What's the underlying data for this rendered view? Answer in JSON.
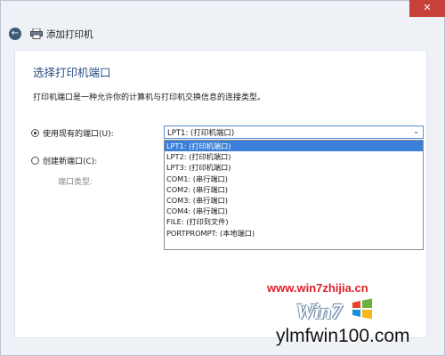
{
  "window": {
    "title": "添加打印机",
    "close_symbol": "✕",
    "back_symbol": "←"
  },
  "content": {
    "heading": "选择打印机端口",
    "description": "打印机端口是一种允许你的计算机与打印机交换信息的连接类型。"
  },
  "options": {
    "use_existing": {
      "label": "使用现有的端口(U):",
      "checked": true
    },
    "create_new": {
      "label": "创建新端口(C):",
      "checked": false
    },
    "port_type_label": "端口类型:"
  },
  "port_select": {
    "selected_value": "LPT1: (打印机端口)",
    "options": [
      "LPT1: (打印机端口)",
      "LPT2: (打印机端口)",
      "LPT3: (打印机端口)",
      "COM1: (串行端口)",
      "COM2: (串行端口)",
      "COM3: (串行端口)",
      "COM4: (串行端口)",
      "FILE: (打印到文件)",
      "PORTPROMPT: (本地端口)"
    ],
    "highlighted_index": 0
  },
  "watermark": {
    "url": "www.win7zhijia.cn",
    "logo_text": "Win7",
    "site": "ylmfwin100.com"
  },
  "colors": {
    "accent": "#3a7fd8",
    "heading": "#2a5082",
    "close": "#c7403a",
    "watermark_red": "#e0202a"
  },
  "icons": {
    "back": "back-arrow-icon",
    "printer": "printer-icon",
    "close": "close-icon",
    "dropdown": "chevron-down-icon"
  }
}
